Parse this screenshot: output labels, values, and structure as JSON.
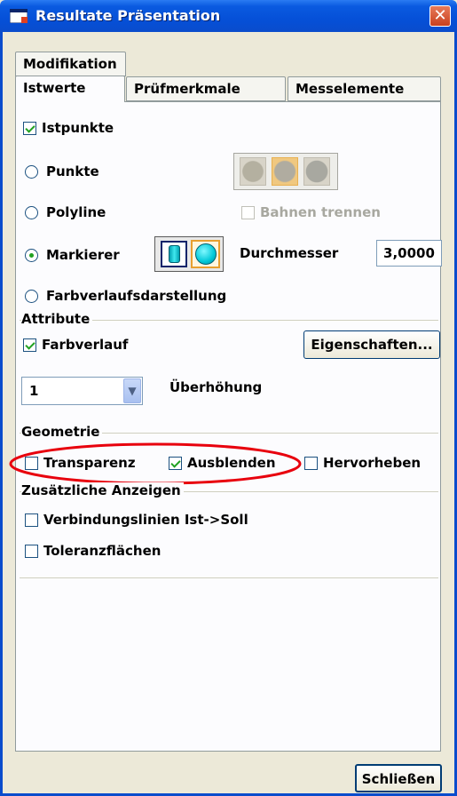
{
  "window": {
    "title": "Resultate Präsentation",
    "close_glyph": "✕"
  },
  "tabs": {
    "row1": [
      "Modifikation"
    ],
    "row2": [
      "Istwerte",
      "Prüfmerkmale",
      "Messelemente"
    ],
    "active": "Istwerte"
  },
  "istpunkte": {
    "label": "Istpunkte",
    "checked": true
  },
  "radios": {
    "punkte": {
      "label": "Punkte",
      "checked": false
    },
    "polyline": {
      "label": "Polyline",
      "checked": false
    },
    "markierer": {
      "label": "Markierer",
      "checked": true
    },
    "farbverlaufsdarstellung": {
      "label": "Farbverlaufsdarstellung",
      "checked": false
    }
  },
  "bahnen_trennen": {
    "label": "Bahnen trennen",
    "checked": false,
    "enabled": false
  },
  "durchmesser": {
    "label": "Durchmesser",
    "value": "3,0000"
  },
  "attribute": {
    "title": "Attribute",
    "farbverlauf": {
      "label": "Farbverlauf",
      "checked": true
    },
    "eigenschaften_button": "Eigenschaften...",
    "combo_value": "1",
    "ueberhoehung_label": "Überhöhung"
  },
  "geometrie": {
    "title": "Geometrie",
    "transparenz": {
      "label": "Transparenz",
      "checked": false
    },
    "ausblenden": {
      "label": "Ausblenden",
      "checked": true
    },
    "hervorheben": {
      "label": "Hervorheben",
      "checked": false
    }
  },
  "zusaetzliche": {
    "title": "Zusätzliche Anzeigen",
    "verbindungslinien": {
      "label": "Verbindungslinien Ist->Soll",
      "checked": false
    },
    "toleranzflaechen": {
      "label": "Toleranzflächen",
      "checked": false
    }
  },
  "schliessen_button": "Schließen",
  "colors": {
    "title_bar": "#0550d8",
    "highlight_ellipse": "#e8000d",
    "marker_cyan": "#00c8d8",
    "check_green": "#21a121"
  }
}
